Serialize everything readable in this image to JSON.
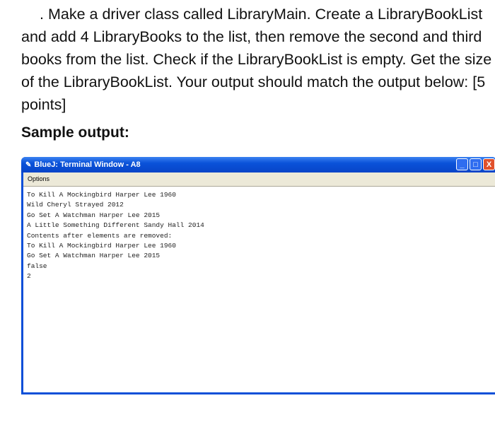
{
  "question": {
    "bullet": ".",
    "text": "Make a driver class called LibraryMain. Create a LibraryBookList and add 4 LibraryBooks to the list, then remove the second and third books from the list. Check if the LibraryBookList is empty. Get the size of the LibraryBookList. Your output should match the output below: [5 points]"
  },
  "sample_label": "Sample output:",
  "window": {
    "title": "BlueJ: Terminal Window - A8",
    "menu": "Options",
    "buttons": {
      "min": "_",
      "max": "□",
      "close": "X"
    },
    "output": [
      "To Kill A Mockingbird Harper Lee 1960",
      "Wild Cheryl Strayed 2012",
      "Go Set A Watchman Harper Lee 2015",
      "A Little Something Different Sandy Hall 2014",
      "Contents after elements are removed:",
      "To Kill A Mockingbird Harper Lee 1960",
      "Go Set A Watchman Harper Lee 2015",
      "false",
      "2"
    ]
  }
}
